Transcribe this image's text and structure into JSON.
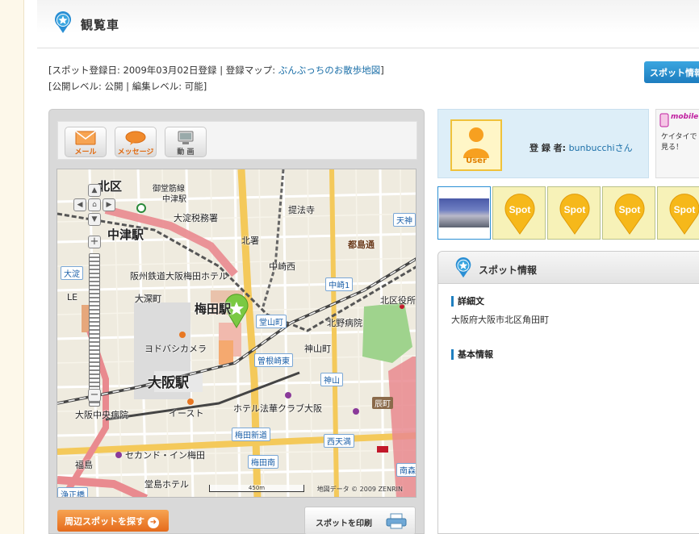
{
  "page": {
    "title": "観覧車"
  },
  "meta": {
    "line1_prefix": "[スポット登録日: 2009年03月02日登録 | 登録マップ: ",
    "line1_link": "ぶんぶっちのお散歩地図",
    "line1_suffix": "]",
    "line2": "[公開レベル: 公開 | 編集レベル: 可能]"
  },
  "spot_info_button": "スポット情報",
  "toolbar": {
    "mail": "メール",
    "message": "メッセージ",
    "video": "動 画"
  },
  "map": {
    "labels": {
      "kita_ku": "北区",
      "midosuji_line": "御堂筋線",
      "nakatsu_eki_small": "中津駅",
      "tax_office": "大淀税務署",
      "teihoji": "提法寺",
      "tenjin": "天神",
      "nakatsu_station": "中津駅",
      "kita_police": "北署",
      "toshima_dori": "都島通",
      "hanshin_hotel": "阪州鉄道大阪梅田ホテル",
      "oyodo": "大淀",
      "nakazaki_nishi": "中崎西",
      "nakazaki1": "中崎1",
      "kita_office": "北区役所",
      "ofukacho": "大深町",
      "umeda_station": "梅田駅",
      "dojimacho": "堂山町",
      "kitano_hospital": "北野病院",
      "yodobashi": "ヨドバシカメラ",
      "kamiyamacho": "神山町",
      "sonezaki_higashi": "曽根崎東",
      "osaka_station": "大阪駅",
      "kamiyama": "神山",
      "tatsumicho": "辰町",
      "chuo_hospital": "大阪中央病院",
      "east": "イースト",
      "hotel_hokke": "ホテル法華クラブ大阪",
      "umeda_shinmichi": "梅田新道",
      "nishi_tenma": "西天満",
      "second_inn": "セカンド・イン梅田",
      "fukushima": "福島",
      "umeda_minami": "梅田南",
      "minami_mori": "南森",
      "dojima_hotel": "堂島ホテル",
      "jo": "浄正橋",
      "le": "LE"
    },
    "scale_label": "450m",
    "credit": "地図データ © 2009 ZENRIN"
  },
  "buttons": {
    "nearby": "周辺スポットを探す",
    "print": "スポットを印刷"
  },
  "user": {
    "avatar_caption": "User",
    "registrant_label": "登 録 者:",
    "registrant_name": "bunbucchiさん"
  },
  "mobile": {
    "label": "mobile",
    "text_line1": "ケイタイで",
    "text_line2": "見る！"
  },
  "thumbs": {
    "spot_label": "Spot"
  },
  "spot_panel": {
    "title": "スポット情報",
    "detail_title": "詳細文",
    "detail_body": "大阪府大阪市北区角田町",
    "basic_title": "基本情報"
  },
  "colors": {
    "accent_blue": "#1d7dbf",
    "orange": "#e56b1c",
    "user_box_bg": "#ddeef8",
    "spot_yellow": "#f7f2b8"
  }
}
